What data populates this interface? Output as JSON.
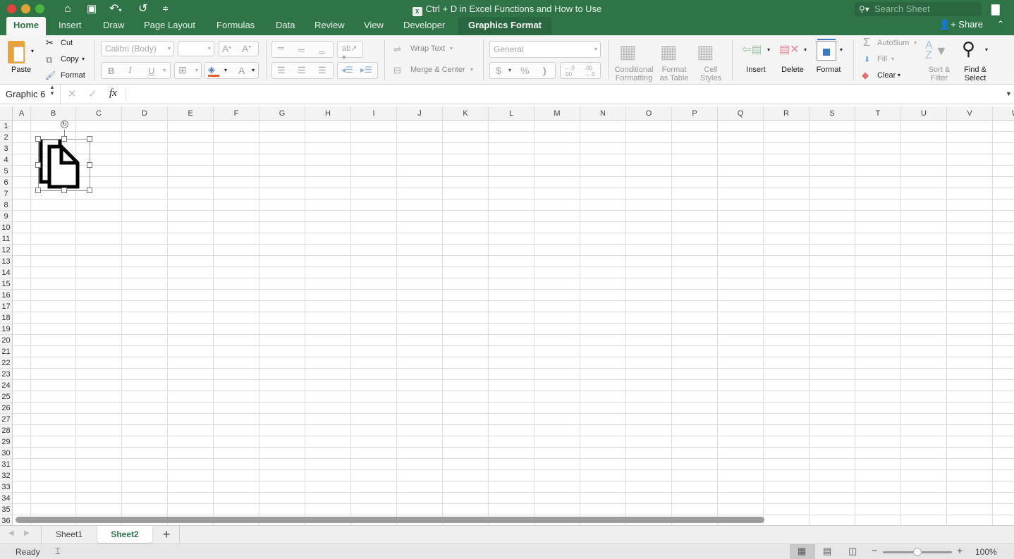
{
  "window": {
    "title": "Ctrl + D in Excel Functions and How to Use",
    "search_placeholder": "Search Sheet",
    "share_label": "Share"
  },
  "quick_access": {
    "icons": [
      "home-icon",
      "save-icon",
      "undo-icon",
      "redo-icon",
      "customize-icon"
    ]
  },
  "tabs": [
    {
      "label": "Home",
      "active": true
    },
    {
      "label": "Insert"
    },
    {
      "label": "Draw"
    },
    {
      "label": "Page Layout"
    },
    {
      "label": "Formulas"
    },
    {
      "label": "Data"
    },
    {
      "label": "Review"
    },
    {
      "label": "View"
    },
    {
      "label": "Developer"
    },
    {
      "label": "Graphics Format",
      "contextual": true
    }
  ],
  "ribbon": {
    "paste": "Paste",
    "cut": "Cut",
    "copy": "Copy",
    "format_painter": "Format",
    "font_name": "Calibri (Body)",
    "font_size": "",
    "bold": "B",
    "italic": "I",
    "underline": "U",
    "font_color": "A",
    "wrap_text": "Wrap Text",
    "merge_center": "Merge & Center",
    "number_format": "General",
    "currency": "$",
    "percent": "%",
    "comma": ")",
    "conditional_formatting": [
      "Conditional",
      "Formatting"
    ],
    "format_as_table": [
      "Format",
      "as Table"
    ],
    "cell_styles": [
      "Cell",
      "Styles"
    ],
    "insert": "Insert",
    "delete": "Delete",
    "format": "Format",
    "autosum": "AutoSum",
    "fill": "Fill",
    "clear": "Clear",
    "sort_filter": [
      "Sort &",
      "Filter"
    ],
    "find_select": [
      "Find &",
      "Select"
    ]
  },
  "formula_bar": {
    "name_box": "Graphic 6",
    "formula": "",
    "fx": "fx"
  },
  "columns": [
    "A",
    "B",
    "C",
    "D",
    "E",
    "F",
    "G",
    "H",
    "I",
    "J",
    "K",
    "L",
    "M",
    "N",
    "O",
    "P",
    "Q",
    "R",
    "S",
    "T",
    "U",
    "V",
    "W"
  ],
  "rows": [
    "1",
    "2",
    "3",
    "4",
    "5",
    "6",
    "7",
    "8",
    "9",
    "10",
    "11",
    "12",
    "13",
    "14",
    "15",
    "16",
    "17",
    "18",
    "19",
    "20",
    "21",
    "22",
    "23",
    "24",
    "25",
    "26",
    "27",
    "28",
    "29",
    "30",
    "31",
    "32",
    "33",
    "34",
    "35",
    "36"
  ],
  "selected_object": {
    "name": "Graphic 6",
    "icon": "copy-documents-icon"
  },
  "sheets": [
    {
      "name": "Sheet1"
    },
    {
      "name": "Sheet2",
      "active": true
    }
  ],
  "add_sheet": "+",
  "status": {
    "ready": "Ready",
    "zoom": "100%",
    "zoom_fraction": 0.5
  },
  "colors": {
    "brand": "#2f7447",
    "active_sheet": "#2f7447"
  }
}
